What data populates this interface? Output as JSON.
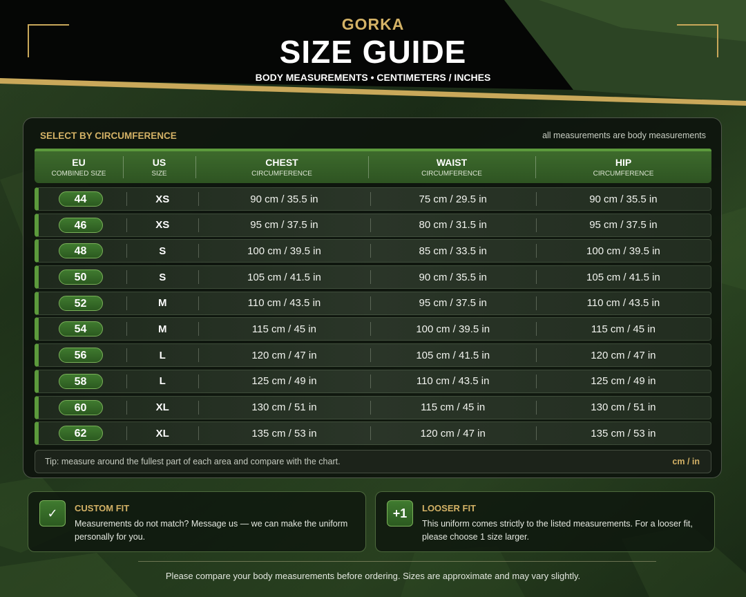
{
  "header": {
    "brand": "GORKA",
    "title": "SIZE GUIDE",
    "subtitle": "BODY MEASUREMENTS • CENTIMETERS / INCHES"
  },
  "panel": {
    "title": "SELECT BY CIRCUMFERENCE",
    "note": "all measurements are body measurements"
  },
  "table": {
    "columns": [
      {
        "label": "EU",
        "sub": "COMBINED SIZE"
      },
      {
        "label": "US",
        "sub": "SIZE"
      },
      {
        "label": "CHEST",
        "sub": "CIRCUMFERENCE"
      },
      {
        "label": "WAIST",
        "sub": "CIRCUMFERENCE"
      },
      {
        "label": "HIP",
        "sub": "CIRCUMFERENCE"
      }
    ],
    "rows": [
      {
        "eu": "44",
        "us": "XS",
        "chest": "90 cm / 35.5 in",
        "waist": "75 cm / 29.5 in",
        "hip": "90 cm / 35.5 in"
      },
      {
        "eu": "46",
        "us": "XS",
        "chest": "95 cm / 37.5 in",
        "waist": "80 cm / 31.5 in",
        "hip": "95 cm / 37.5 in"
      },
      {
        "eu": "48",
        "us": "S",
        "chest": "100 cm / 39.5 in",
        "waist": "85 cm / 33.5 in",
        "hip": "100 cm / 39.5 in"
      },
      {
        "eu": "50",
        "us": "S",
        "chest": "105 cm / 41.5 in",
        "waist": "90 cm / 35.5 in",
        "hip": "105 cm / 41.5 in"
      },
      {
        "eu": "52",
        "us": "M",
        "chest": "110 cm / 43.5 in",
        "waist": "95 cm / 37.5 in",
        "hip": "110 cm / 43.5 in"
      },
      {
        "eu": "54",
        "us": "M",
        "chest": "115 cm / 45 in",
        "waist": "100 cm / 39.5 in",
        "hip": "115 cm / 45 in"
      },
      {
        "eu": "56",
        "us": "L",
        "chest": "120 cm / 47 in",
        "waist": "105 cm / 41.5 in",
        "hip": "120 cm / 47 in"
      },
      {
        "eu": "58",
        "us": "L",
        "chest": "125 cm / 49 in",
        "waist": "110 cm / 43.5 in",
        "hip": "125 cm / 49 in"
      },
      {
        "eu": "60",
        "us": "XL",
        "chest": "130 cm / 51 in",
        "waist": "115 cm / 45 in",
        "hip": "130 cm / 51 in"
      },
      {
        "eu": "62",
        "us": "XL",
        "chest": "135 cm / 53 in",
        "waist": "120 cm / 47 in",
        "hip": "135 cm / 53 in"
      }
    ]
  },
  "tip": {
    "text": "Tip: measure around the fullest part of each area and compare with the chart.",
    "units": "cm / in"
  },
  "info": {
    "custom_fit": {
      "icon": "checkmark-icon",
      "icon_glyph": "✓",
      "title": "CUSTOM FIT",
      "text": "Measurements do not match? Message us — we can make the uniform personally for you."
    },
    "looser_fit": {
      "icon": "plus-one-icon",
      "icon_glyph": "+1",
      "title": "LOOSER FIT",
      "text": "This uniform comes strictly to the listed measurements. For a looser fit, please choose 1 size larger."
    }
  },
  "footer": "Please compare your body measurements before ordering. Sizes are approximate and may vary slightly.",
  "colors": {
    "accent_gold": "#d4b266",
    "accent_green": "#5c9a3c",
    "header_black": "#050605",
    "background_green": "#1f3219"
  }
}
